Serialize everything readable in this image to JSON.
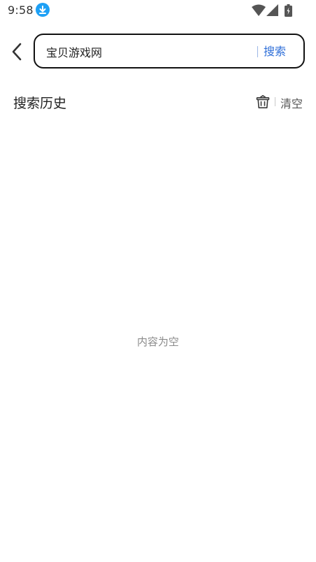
{
  "status_bar": {
    "time": "9:58",
    "icons": [
      "download-icon",
      "wifi-icon",
      "signal-icon",
      "battery-charging-icon"
    ],
    "download_color": "#1ea0f5"
  },
  "search": {
    "value": "宝贝游戏网",
    "button_label": "搜索",
    "accent_color": "#2f6fd8"
  },
  "history": {
    "title": "搜索历史",
    "clear_label": "清空",
    "items": []
  },
  "empty_state": {
    "text": "内容为空"
  }
}
